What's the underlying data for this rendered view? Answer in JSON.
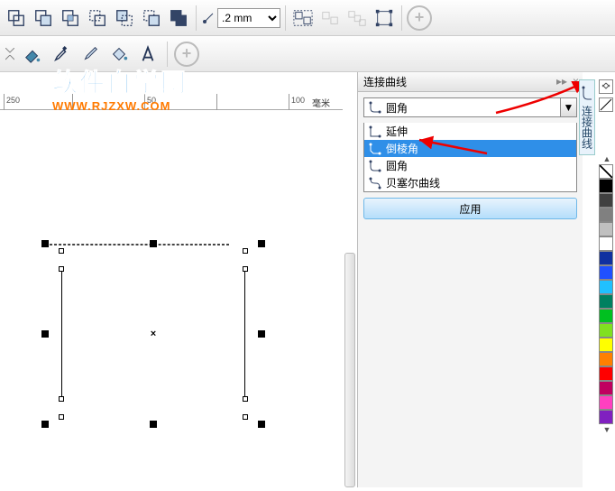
{
  "toolbar": {
    "line_width_value": ".2 mm"
  },
  "ruler": {
    "ticks": [
      "250",
      "50",
      "100"
    ],
    "unit": "毫米"
  },
  "docker": {
    "title": "连接曲线",
    "selected": "圆角",
    "options": [
      "延伸",
      "倒棱角",
      "圆角",
      "贝塞尔曲线"
    ],
    "apply": "应用"
  },
  "vtab": {
    "label": "连接曲线"
  },
  "watermark": {
    "cn": "软件自学网",
    "url": "WWW.RJZXW.COM"
  },
  "palette": {
    "colors": [
      "#000000",
      "#404040",
      "#808080",
      "#c0c0c0",
      "#ffffff",
      "#1030a0",
      "#2050ff",
      "#20c0ff",
      "#008060",
      "#00c020",
      "#80e020",
      "#ffff00",
      "#ff8000",
      "#ff0000",
      "#c00060",
      "#ff40c0",
      "#8020c0"
    ]
  }
}
